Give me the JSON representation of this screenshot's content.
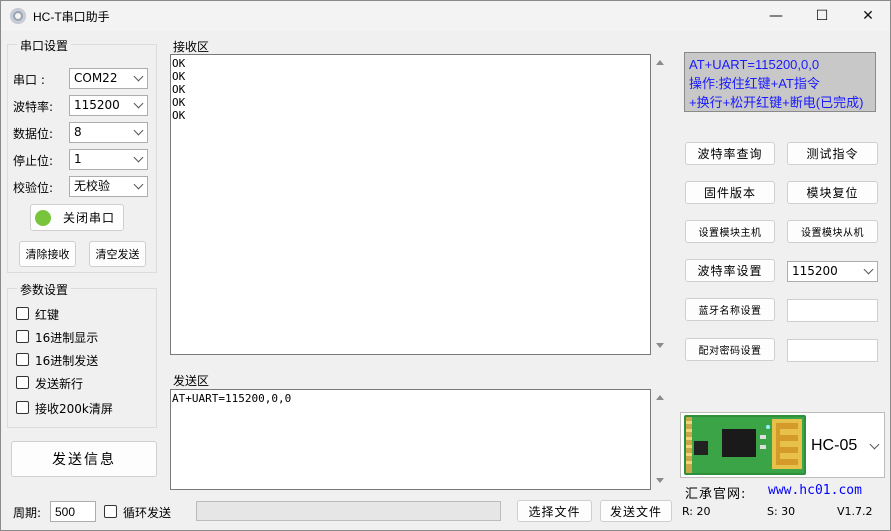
{
  "window": {
    "title": "HC-T串口助手",
    "minimize": "—",
    "maximize": "☐",
    "close": "✕"
  },
  "serial": {
    "group_label": "串口设置",
    "port_label": "串口  :",
    "port_value": "COM22",
    "baud_label": "波特率:",
    "baud_value": "115200",
    "databits_label": "数据位:",
    "databits_value": "8",
    "stopbits_label": "停止位:",
    "stopbits_value": "1",
    "parity_label": "校验位:",
    "parity_value": "无校验",
    "close_port_label": "关闭串口",
    "clear_recv_label": "清除接收",
    "clear_send_label": "清空发送",
    "status_color": "#78c43c"
  },
  "params": {
    "group_label": "参数设置",
    "options": [
      {
        "label": "红键",
        "checked": false
      },
      {
        "label": "16进制显示",
        "checked": false
      },
      {
        "label": "16进制发送",
        "checked": false
      },
      {
        "label": "发送新行",
        "checked": false
      },
      {
        "label": "接收200k清屏",
        "checked": false
      }
    ]
  },
  "send_info_label": "发送信息",
  "receive": {
    "label": "接收区",
    "lines": [
      "OK",
      "OK",
      "OK",
      "OK",
      "OK"
    ]
  },
  "send": {
    "label": "发送区",
    "text": "AT+UART=115200,0,0"
  },
  "bottom": {
    "period_label": "周期:",
    "period_value": "500",
    "loop_send_label": "循环发送",
    "choose_file_label": "选择文件",
    "send_file_label": "发送文件",
    "r_label": "R: 20",
    "s_label": "S: 30",
    "version": "V1.7.2"
  },
  "right": {
    "info_lines": [
      "AT+UART=115200,0,0",
      "操作:按住红键+AT指令",
      "+换行+松开红键+断电(已完成)"
    ],
    "info_color": "#1a1aff",
    "baud_query_label": "波特率查询",
    "test_cmd_label": "测试指令",
    "firmware_label": "固件版本",
    "module_reset_label": "模块复位",
    "set_master_label": "设置模块主机",
    "set_slave_label": "设置模块从机",
    "baud_set_label": "波特率设置",
    "baud_set_value": "115200",
    "bt_name_label": "蓝牙名称设置",
    "bt_name_value": "",
    "pair_pwd_label": "配对密码设置",
    "pair_pwd_value": "",
    "module_name": "HC-05",
    "website_label": "汇承官网:",
    "website_url": "www.hc01.com"
  }
}
